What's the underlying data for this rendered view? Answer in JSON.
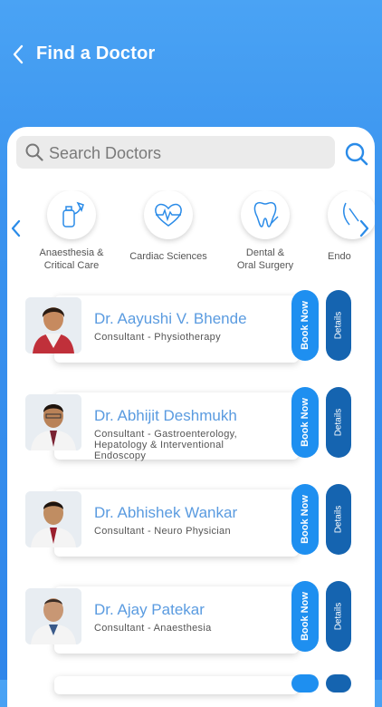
{
  "header": {
    "title": "Find a Doctor"
  },
  "search": {
    "placeholder": "Search Doctors"
  },
  "categories": [
    {
      "label_line1": "Anaesthesia &",
      "label_line2": "Critical Care",
      "icon": "oxygen-mask-icon"
    },
    {
      "label_line1": "Cardiac Sciences",
      "label_line2": "",
      "icon": "heart-pulse-icon"
    },
    {
      "label_line1": "Dental &",
      "label_line2": "Oral Surgery",
      "icon": "tooth-icon"
    },
    {
      "label_line1": "Endo",
      "label_line2": "",
      "icon": "endocrine-icon"
    }
  ],
  "doctors": [
    {
      "name": "Dr. Aayushi V. Bhende",
      "specialty": "Consultant -  Physiotherapy",
      "book_label": "Book Now",
      "details_label": "Details"
    },
    {
      "name": "Dr. Abhijit Deshmukh",
      "specialty": "Consultant - Gastroenterology, Hepatology & Interventional Endoscopy",
      "book_label": "Book Now",
      "details_label": "Details"
    },
    {
      "name": "Dr. Abhishek Wankar",
      "specialty": "Consultant - Neuro Physician",
      "book_label": "Book Now",
      "details_label": "Details"
    },
    {
      "name": "Dr. Ajay Patekar",
      "specialty": "Consultant - Anaesthesia",
      "book_label": "Book Now",
      "details_label": "Details"
    }
  ],
  "colors": {
    "primary": "#3a93ef",
    "book": "#1e8ff0",
    "details": "#1564b0",
    "name": "#5a9be0"
  }
}
